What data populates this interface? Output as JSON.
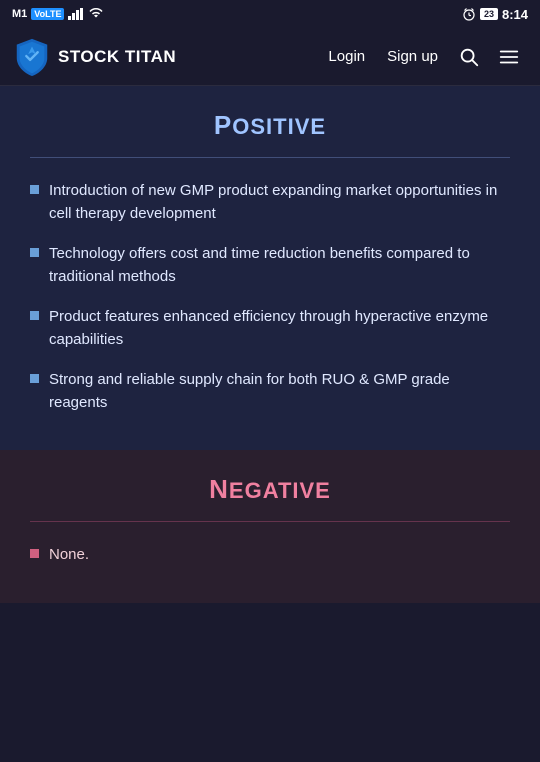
{
  "statusBar": {
    "carrier": "M1",
    "volte": "VoLTE",
    "time": "8:14",
    "battery": "23"
  },
  "navbar": {
    "logoText": "STOCK TITAN",
    "loginLabel": "Login",
    "signupLabel": "Sign up"
  },
  "positiveSection": {
    "title": "Positive",
    "bullets": [
      "Introduction of new GMP product expanding market opportunities in cell therapy development",
      "Technology offers cost and time reduction benefits compared to traditional methods",
      "Product features enhanced efficiency through hyperactive enzyme capabilities",
      "Strong and reliable supply chain for both RUO & GMP grade reagents"
    ]
  },
  "negativeSection": {
    "title": "Negative",
    "bullets": [
      "None."
    ]
  }
}
